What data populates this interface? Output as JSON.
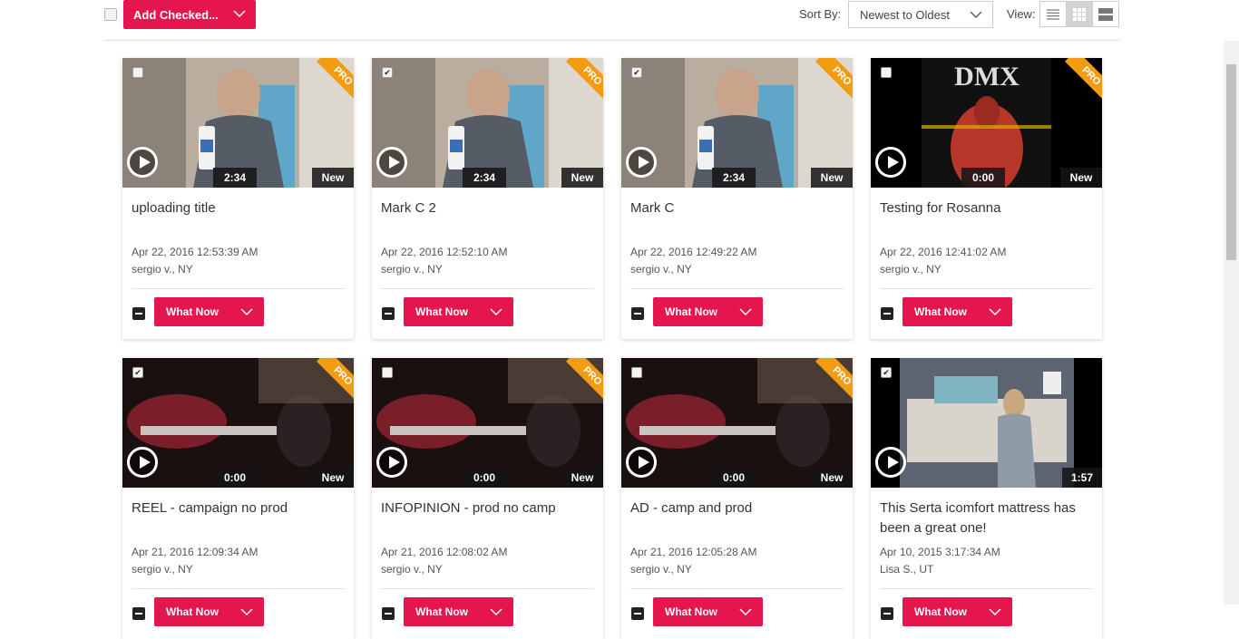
{
  "toolbar": {
    "add_checked_label": "Add Checked...",
    "sort_label": "Sort By:",
    "sort_value": "Newest to Oldest",
    "view_label": "View:",
    "views": [
      "list-view-icon",
      "grid-view-icon",
      "large-view-icon"
    ],
    "active_view": "grid-view-icon"
  },
  "colors": {
    "accent": "#e5154d",
    "pro_ribbon": "#f39c12"
  },
  "videos": [
    {
      "title": "uploading title",
      "date": "Apr 22, 2016 12:53:39 AM",
      "author": "sergio v., NY",
      "duration": "2:34",
      "badge": "New",
      "pro": "PRO",
      "checked": false,
      "action": "What Now"
    },
    {
      "title": "Mark C 2",
      "date": "Apr 22, 2016 12:52:10 AM",
      "author": "sergio v., NY",
      "duration": "2:34",
      "badge": "New",
      "pro": "PRO",
      "checked": true,
      "action": "What Now"
    },
    {
      "title": "Mark C",
      "date": "Apr 22, 2016 12:49:22 AM",
      "author": "sergio v., NY",
      "duration": "2:34",
      "badge": "New",
      "pro": "PRO",
      "checked": true,
      "action": "What Now"
    },
    {
      "title": "Testing for Rosanna",
      "date": "Apr 22, 2016 12:41:02 AM",
      "author": "sergio v., NY",
      "duration": "0:00",
      "badge": "New",
      "pro": "PRO",
      "checked": false,
      "action": "What Now",
      "thumb_text": "DMX"
    },
    {
      "title": "REEL - campaign no prod",
      "date": "Apr 21, 2016 12:09:34 AM",
      "author": "sergio v., NY",
      "duration": "0:00",
      "badge": "New",
      "pro": "PRO",
      "checked": true,
      "action": "What Now"
    },
    {
      "title": "INFOPINION - prod no camp",
      "date": "Apr 21, 2016 12:08:02 AM",
      "author": "sergio v., NY",
      "duration": "0:00",
      "badge": "New",
      "pro": "PRO",
      "checked": false,
      "action": "What Now"
    },
    {
      "title": "AD - camp and prod",
      "date": "Apr 21, 2016 12:05:28 AM",
      "author": "sergio v., NY",
      "duration": "0:00",
      "badge": "New",
      "pro": "PRO",
      "checked": false,
      "action": "What Now"
    },
    {
      "title": "This Serta icomfort mattress has been a great one!",
      "date": "Apr 10, 2015 3:17:34 AM",
      "author": "Lisa S., UT",
      "duration": "1:57",
      "badge": "",
      "pro": "",
      "checked": true,
      "action": "What Now"
    }
  ]
}
